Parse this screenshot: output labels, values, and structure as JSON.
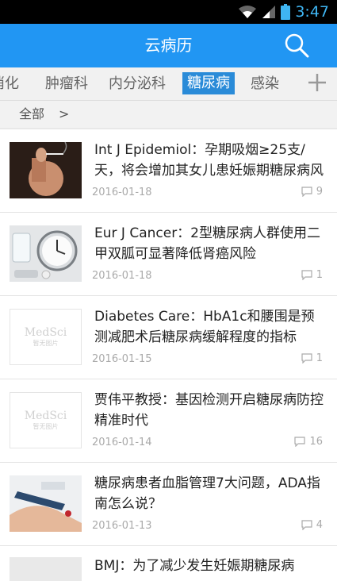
{
  "status": {
    "time": "3:47"
  },
  "appbar": {
    "title": "云病历",
    "search_icon": "search-icon"
  },
  "tabs": [
    "消化",
    "肿瘤科",
    "内分泌科",
    "糖尿病",
    "感染"
  ],
  "active_tab": "糖尿病",
  "crumb": {
    "label": "全部",
    "arrow": ">"
  },
  "articles": [
    {
      "title": "Int J Epidemiol：孕期吸烟≥25支/天，将会增加其女儿患妊娠期糖尿病风险",
      "date": "2016-01-18",
      "comments": "9",
      "image": "pregnant-woman-smoking"
    },
    {
      "title": "Eur J Cancer：2型糖尿病人群使用二甲双胍可显著降低肾癌风险",
      "date": "2016-01-18",
      "comments": "1",
      "image": "clock-water-pills"
    },
    {
      "title": "Diabetes Care：HbA1c和腰围是预测减肥术后糖尿病缓解程度的指标",
      "date": "2016-01-15",
      "comments": "1",
      "image": "medsci-placeholder"
    },
    {
      "title": "贾伟平教授：基因检测开启糖尿病防控精准时代",
      "date": "2016-01-14",
      "comments": "16",
      "image": "medsci-placeholder"
    },
    {
      "title": "糖尿病患者血脂管理7大问题，ADA指南怎么说？",
      "date": "2016-01-13",
      "comments": "4",
      "image": "blood-glucose-test"
    }
  ],
  "placeholder": {
    "logo": "MedSci",
    "sub": "暂无图片"
  },
  "partial_title": "BMJ：为了减少发生妊娠期糖尿病"
}
